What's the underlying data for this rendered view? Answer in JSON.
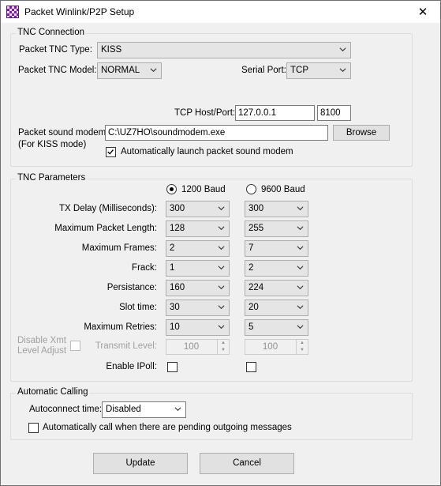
{
  "window": {
    "title": "Packet Winlink/P2P Setup",
    "close_glyph": "✕"
  },
  "tnc_connection": {
    "title": "TNC Connection",
    "type_label": "Packet TNC Type:",
    "type_value": "KISS",
    "model_label": "Packet TNC Model:",
    "model_value": "NORMAL",
    "serial_label": "Serial Port:",
    "serial_value": "TCP",
    "host_label": "TCP Host/Port:",
    "host_value": "127.0.0.1",
    "port_value": "8100",
    "modem_label": "Packet sound modem:",
    "modem_sub_label": "(For KISS mode)",
    "modem_path": "C:\\UZ7HO\\soundmodem.exe",
    "browse_label": "Browse",
    "auto_launch_label": "Automatically launch packet sound modem",
    "auto_launch_checked": true
  },
  "tnc_parameters": {
    "title": "TNC Parameters",
    "baud_1200_label": "1200 Baud",
    "baud_9600_label": "9600 Baud",
    "selected_baud": "1200",
    "rows": [
      {
        "label": "TX Delay (Milliseconds):",
        "v1200": "300",
        "v9600": "300"
      },
      {
        "label": "Maximum Packet Length:",
        "v1200": "128",
        "v9600": "255"
      },
      {
        "label": "Maximum Frames:",
        "v1200": "2",
        "v9600": "7"
      },
      {
        "label": "Frack:",
        "v1200": "1",
        "v9600": "2"
      },
      {
        "label": "Persistance:",
        "v1200": "160",
        "v9600": "224"
      },
      {
        "label": "Slot time:",
        "v1200": "30",
        "v9600": "20"
      },
      {
        "label": "Maximum Retries:",
        "v1200": "10",
        "v9600": "5"
      }
    ],
    "disable_xmt_label_1": "Disable Xmt",
    "disable_xmt_label_2": "Level Adjust",
    "transmit_level_label": "Transmit Level:",
    "transmit_level_1200": "100",
    "transmit_level_9600": "100",
    "enable_ipoll_label": "Enable IPoll:"
  },
  "automatic_calling": {
    "title": "Automatic Calling",
    "autoconnect_label": "Autoconnect time:",
    "autoconnect_value": "Disabled",
    "auto_call_label": "Automatically call when there are pending outgoing messages"
  },
  "buttons": {
    "update": "Update",
    "cancel": "Cancel"
  },
  "icons": {
    "dropdown": "chevron-down-icon",
    "app": "winlink-app-icon"
  }
}
